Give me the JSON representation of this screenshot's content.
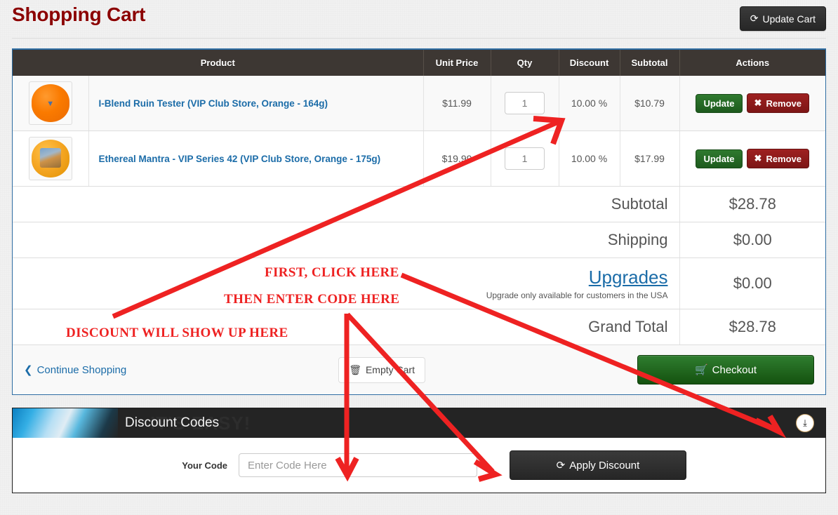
{
  "header": {
    "title": "Shopping Cart",
    "update_cart_label": "Update Cart",
    "update_cart_icon": "refresh-icon"
  },
  "cart": {
    "columns": [
      "",
      "Product",
      "Unit Price",
      "Qty",
      "Discount",
      "Subtotal",
      "Actions"
    ],
    "items": [
      {
        "name": "I-Blend Ruin Tester (VIP Club Store, Orange - 164g)",
        "unit_price": "$11.99",
        "qty": "1",
        "discount": "10.00 %",
        "subtotal": "$10.79",
        "update_label": "Update",
        "remove_label": "Remove",
        "remove_icon": "x-icon",
        "thumb": "orange-disc-thumbnail"
      },
      {
        "name": "Ethereal Mantra - VIP Series 42 (VIP Club Store, Orange - 175g)",
        "unit_price": "$19.99",
        "qty": "1",
        "discount": "10.00 %",
        "subtotal": "$17.99",
        "update_label": "Update",
        "remove_label": "Remove",
        "remove_icon": "x-icon",
        "thumb": "gold-disc-thumbnail"
      }
    ],
    "summary": {
      "subtotal_label": "Subtotal",
      "subtotal_value": "$28.78",
      "shipping_label": "Shipping",
      "shipping_value": "$0.00",
      "upgrades_label": "Upgrades",
      "upgrades_note": "Upgrade only available for customers in the USA",
      "upgrades_value": "$0.00",
      "grand_total_label": "Grand Total",
      "grand_total_value": "$28.78"
    },
    "footer": {
      "continue_label": "Continue Shopping",
      "continue_icon": "chevron-left-icon",
      "empty_label": "Empty Cart",
      "empty_icon": "trash-icon",
      "checkout_label": "Checkout",
      "checkout_icon": "cart-icon"
    }
  },
  "discount_panel": {
    "title": "Discount Codes",
    "watermark": "IT'S EASY!",
    "toggle_icon": "arrow-down-circle-icon",
    "code_label": "Your Code",
    "code_value": "",
    "code_placeholder": "Enter Code Here",
    "apply_label": "Apply Discount",
    "apply_icon": "refresh-icon"
  },
  "annotations": {
    "accent_color": "#ee2222",
    "first_click": "FIRST, CLICK HERE",
    "then_enter": "THEN ENTER CODE HERE",
    "discount_shows": "DISCOUNT WILL SHOW UP HERE"
  },
  "colors": {
    "title": "#8b0000",
    "link": "#1b6ca8",
    "header_row": "#3d3733",
    "panel_border": "#2d6ca2",
    "checkout_green": "#1d6b1a",
    "remove_red": "#8d1b1b",
    "annotation_red": "#ee2222"
  }
}
